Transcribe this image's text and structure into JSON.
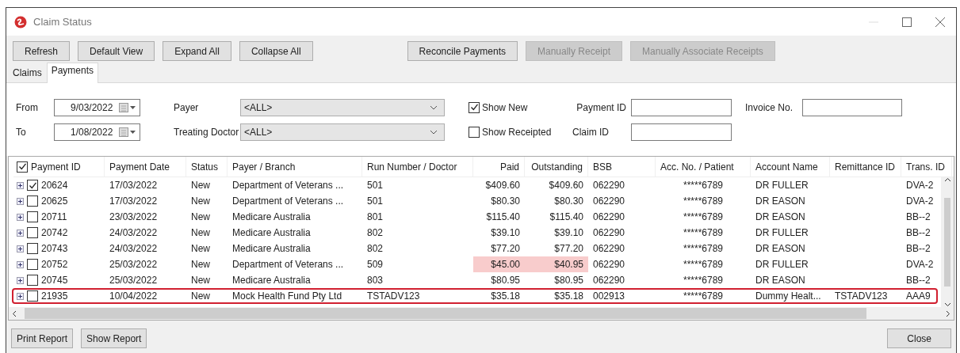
{
  "window": {
    "title": "Claim Status"
  },
  "toolbar": [
    {
      "label": "Refresh",
      "disabled": false
    },
    {
      "label": "Default View",
      "disabled": false
    },
    {
      "label": "Expand All",
      "disabled": false
    },
    {
      "label": "Collapse All",
      "disabled": false
    },
    {
      "label": "Reconcile Payments",
      "disabled": false
    },
    {
      "label": "Manually Receipt",
      "disabled": true
    },
    {
      "label": "Manually Associate Receipts",
      "disabled": true
    }
  ],
  "tabs": [
    {
      "label": "Claims",
      "selected": false
    },
    {
      "label": "Payments",
      "selected": true
    }
  ],
  "filters": {
    "from_label": "From",
    "from_value": "9/03/2022",
    "to_label": "To",
    "to_value": "1/08/2022",
    "payer_label": "Payer",
    "payer_value": "<ALL>",
    "doctor_label": "Treating Doctor",
    "doctor_value": "<ALL>",
    "show_new": {
      "label": "Show New",
      "checked": true
    },
    "show_receipted": {
      "label": "Show Receipted",
      "checked": false
    },
    "payment_id_label": "Payment ID",
    "claim_id_label": "Claim ID",
    "invoice_label": "Invoice No."
  },
  "table": {
    "header_checked": true,
    "columns": [
      "Payment ID",
      "Payment Date",
      "Status",
      "Payer / Branch",
      "Run Number / Doctor",
      "Paid",
      "Outstanding",
      "BSB",
      "Acc. No. / Patient",
      "Account Name",
      "Remittance ID",
      "Trans. ID"
    ],
    "rows": [
      {
        "expanded": false,
        "checked": true,
        "highlighted": false,
        "selected": false,
        "cells": [
          "20624",
          "17/03/2022",
          "New",
          "Department of Veterans ...",
          "501",
          "$409.60",
          "$409.60",
          "062290",
          "*****6789",
          "DR FULLER",
          "",
          "DVA-2"
        ]
      },
      {
        "expanded": false,
        "checked": false,
        "highlighted": false,
        "selected": false,
        "cells": [
          "20625",
          "17/03/2022",
          "New",
          "Department of Veterans ...",
          "501",
          "$80.30",
          "$80.30",
          "062290",
          "*****6789",
          "DR EASON",
          "",
          "DVA-2"
        ]
      },
      {
        "expanded": false,
        "checked": false,
        "highlighted": false,
        "selected": false,
        "cells": [
          "20711",
          "23/03/2022",
          "New",
          "Medicare Australia",
          "801",
          "$115.40",
          "$115.40",
          "062290",
          "*****6789",
          "DR EASON",
          "",
          "BB--2"
        ]
      },
      {
        "expanded": false,
        "checked": false,
        "highlighted": false,
        "selected": false,
        "cells": [
          "20742",
          "24/03/2022",
          "New",
          "Medicare Australia",
          "802",
          "$39.10",
          "$39.10",
          "062290",
          "*****6789",
          "DR FULLER",
          "",
          "BB--2"
        ]
      },
      {
        "expanded": false,
        "checked": false,
        "highlighted": false,
        "selected": false,
        "cells": [
          "20743",
          "24/03/2022",
          "New",
          "Medicare Australia",
          "802",
          "$77.20",
          "$77.20",
          "062290",
          "*****6789",
          "DR EASON",
          "",
          "BB--2"
        ]
      },
      {
        "expanded": false,
        "checked": false,
        "highlighted": true,
        "selected": false,
        "cells": [
          "20752",
          "25/03/2022",
          "New",
          "Department of Veterans ...",
          "509",
          "$45.00",
          "$40.95",
          "062290",
          "*****6789",
          "DR FULLER",
          "",
          "DVA-2"
        ]
      },
      {
        "expanded": false,
        "checked": false,
        "highlighted": false,
        "selected": false,
        "cells": [
          "20745",
          "25/03/2022",
          "New",
          "Medicare Australia",
          "803",
          "$80.95",
          "$80.95",
          "062290",
          "*****6789",
          "DR EASON",
          "",
          "BB--2"
        ]
      },
      {
        "expanded": false,
        "checked": false,
        "highlighted": false,
        "selected": true,
        "cells": [
          "21935",
          "10/04/2022",
          "New",
          "Mock Health Fund Pty Ltd",
          "TSTADV123",
          "$35.18",
          "$35.18",
          "002913",
          "*****6789",
          "Dummy Healt...",
          "TSTADV123",
          "AAA9"
        ]
      }
    ]
  },
  "footer": {
    "left_buttons": [
      "Print Report",
      "Show Report"
    ],
    "close": "Close"
  }
}
